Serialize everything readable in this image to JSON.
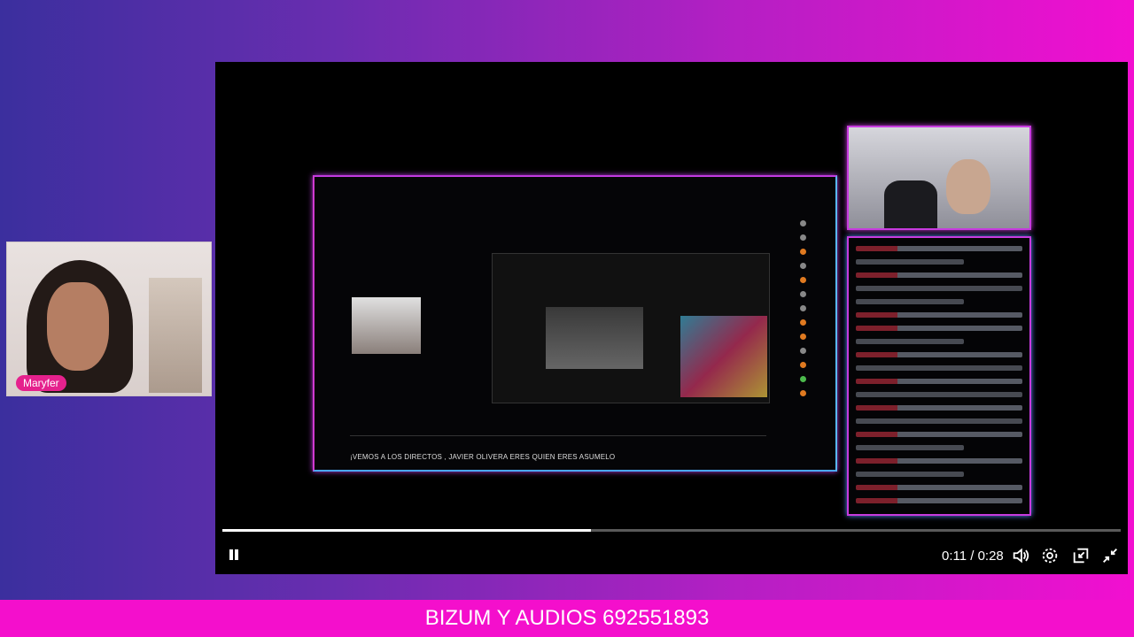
{
  "webcam": {
    "name_tag": "Maryfer"
  },
  "inner_stream": {
    "caption": "¡VEMOS A LOS DIRECTOS , JAVIER OLIVERA ERES QUIEN ERES ASUMELO"
  },
  "player": {
    "time_display": "0:11 / 0:28",
    "progress_fraction": 0.41,
    "icons": [
      "pause-icon",
      "volume-icon",
      "settings-icon",
      "mini-player-icon",
      "exit-fullscreen-icon"
    ]
  },
  "banner": {
    "text": "BIZUM Y AUDIOS 692551893"
  }
}
